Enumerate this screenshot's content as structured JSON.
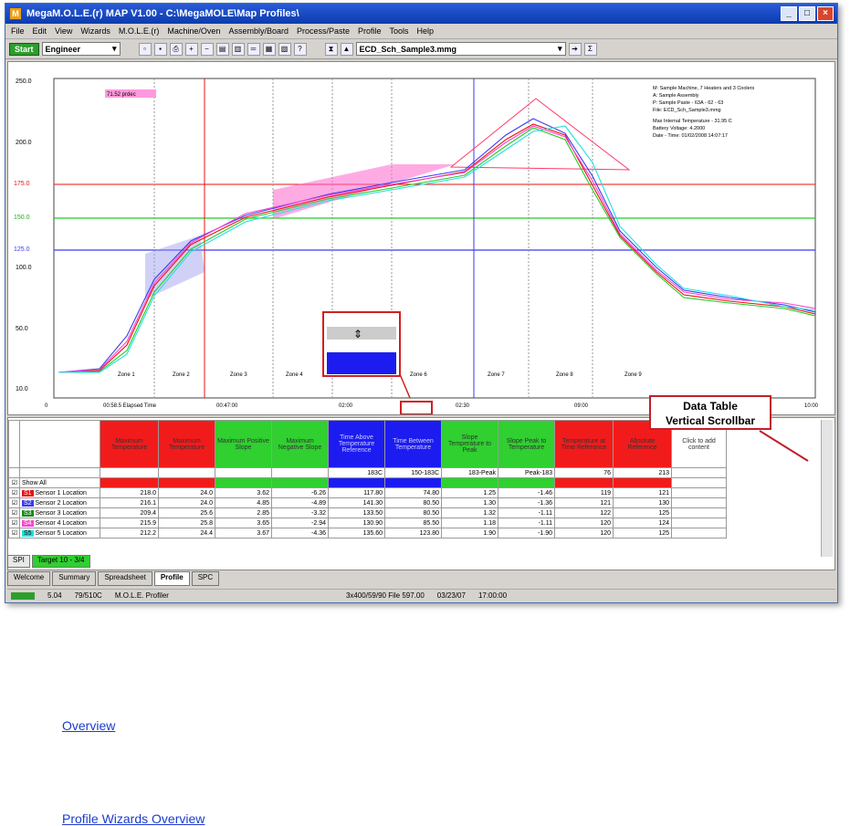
{
  "window": {
    "title": "MegaM.O.L.E.(r) MAP V1.00 - C:\\MegaMOLE\\Map Profiles\\",
    "app_icon": "app-logo-icon"
  },
  "menu": [
    "File",
    "Edit",
    "View",
    "Wizards",
    "M.O.L.E.(r)",
    "Machine/Oven",
    "Assembly/Board",
    "Process/Paste",
    "Profile",
    "Tools",
    "Help"
  ],
  "toolbar": {
    "start_label": "Start",
    "user_level": "Engineer",
    "profile_file": "ECD_Sch_Sample3.mmg"
  },
  "chart": {
    "y_ticks": [
      "250.0",
      "200.0",
      "175.0",
      "150.0",
      "125.0",
      "100.0",
      "50.0",
      "10.0"
    ],
    "x_ticks": [
      "0",
      "00:58.5 Elapsed Time",
      "00:47:00",
      "02:00",
      "02:30",
      "09:00",
      "10:00"
    ],
    "tag_label": "71.52 prdec",
    "zones": [
      "Zone 1",
      "Zone 2",
      "Zone 3",
      "Zone 4",
      "Zone 5",
      "Zone 6",
      "Zone 7",
      "Zone 8",
      "Zone 9"
    ],
    "info": [
      "M: Sample Machine, 7 Heaters and 3 Coolers",
      "A: Sample Assembly",
      "P: Sample Paste - 63A - 62 - 63",
      "File: ECD_Sch_Sample3.mmg",
      "Max Internal Temperature - 31.95 C",
      "Battery Voltage: 4.2000",
      "Date - Time: 01/02/2008 14:07:17"
    ],
    "colors": {
      "red": "#e81010",
      "green": "#22cc22",
      "blue": "#3a3af0",
      "magenta": "#ff44cc",
      "cyan": "#22e0e0"
    }
  },
  "chart_data": {
    "type": "line",
    "series": [
      {
        "name": "Sensor 1 Location"
      },
      {
        "name": "Sensor 2 Location"
      },
      {
        "name": "Sensor 3 Location"
      },
      {
        "name": "Sensor 4 Location"
      },
      {
        "name": "Sensor 5 Location"
      }
    ]
  },
  "table": {
    "headers": [
      "Maximum Temperature",
      "Maximum Temperature",
      "Maximum Positive Slope",
      "Maximum Negative Slope",
      "Time Above Temperature Reference",
      "Time Between Temperature",
      "Slope Temperature to Peak",
      "Slope Peak to Temperature",
      "Temperature at Time Reference",
      "Absolute Reference",
      "Click to add content"
    ],
    "specs": [
      "",
      "",
      "",
      "",
      "183C",
      "150-183C",
      "183-Peak",
      "Peak-183",
      "76",
      "213",
      ""
    ],
    "show_all": "Show All",
    "rows": [
      {
        "id": "S1",
        "name": "Sensor 1 Location",
        "vals": [
          "218.0",
          "24.0",
          "3.62",
          "-6.26",
          "117.80",
          "74.80",
          "1.25",
          "-1.46",
          "119",
          "121"
        ]
      },
      {
        "id": "S2",
        "name": "Sensor 2 Location",
        "vals": [
          "216.1",
          "24.0",
          "4.85",
          "-4.89",
          "141.30",
          "80.50",
          "1.30",
          "-1.36",
          "121",
          "130"
        ]
      },
      {
        "id": "S3",
        "name": "Sensor 3 Location",
        "vals": [
          "209.4",
          "25.6",
          "2.85",
          "-3.32",
          "133.50",
          "80.50",
          "1.32",
          "-1.11",
          "122",
          "125"
        ]
      },
      {
        "id": "S4",
        "name": "Sensor 4 Location",
        "vals": [
          "215.9",
          "25.8",
          "3.65",
          "-2.94",
          "130.90",
          "85.50",
          "1.18",
          "-1.11",
          "120",
          "124"
        ]
      },
      {
        "id": "S5",
        "name": "Sensor 5 Location",
        "vals": [
          "212.2",
          "24.4",
          "3.67",
          "-4.36",
          "135.60",
          "123.80",
          "1.90",
          "-1.90",
          "120",
          "125"
        ]
      }
    ]
  },
  "inner_tabs": [
    "SPI",
    "Target 10 - 3/4"
  ],
  "outer_tabs": [
    "Welcome",
    "Summary",
    "Spreadsheet",
    "Profile",
    "SPC"
  ],
  "status": [
    "5.04",
    "79/510C",
    "M.O.L.E. Profiler",
    "3x400/59/90 File 597.00",
    "03/23/07",
    "17:00:00"
  ],
  "callout": {
    "line1": "Data Table",
    "line2": "Vertical Scrollbar"
  },
  "links": {
    "first": "Overview",
    "second": "Profile Wizards Overview"
  }
}
